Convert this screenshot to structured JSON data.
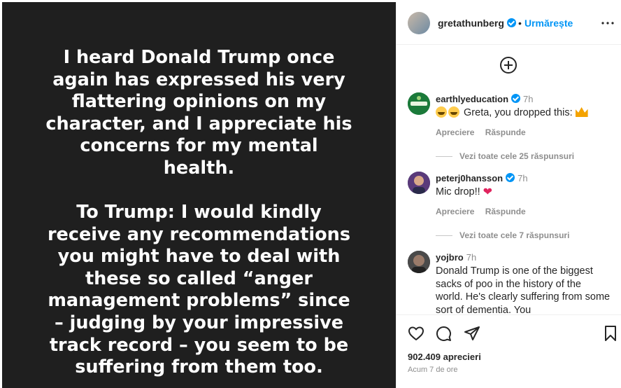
{
  "post": {
    "paragraph1": "I heard Donald Trump once\nagain has expressed his very\nflattering opinions on my\ncharacter, and I appreciate his\nconcerns for my mental\nhealth.",
    "paragraph2": "To Trump: I would kindly\nreceive any recommendations\nyou might have to deal with\nthese so called “anger\nmanagement problems” since\n– judging by your impressive\ntrack record – you seem to be\nsuffering from them too."
  },
  "header": {
    "username": "gretathunberg",
    "separator": "•",
    "follow_label": "Urmărește",
    "more_label": "•••"
  },
  "comments": [
    {
      "username": "earthlyeducation",
      "time": "7h",
      "text": "Greta, you dropped this:",
      "like_label": "Apreciere",
      "reply_label": "Răspunde",
      "replies_label": "Vezi toate cele 25 răspunsuri",
      "avatar_color": "#1b7a3a"
    },
    {
      "username": "peterj0hansson",
      "time": "7h",
      "text": "Mic drop!!",
      "like_label": "Apreciere",
      "reply_label": "Răspunde",
      "replies_label": "Vezi toate cele 7 răspunsuri",
      "avatar_color": "#3b4a7a"
    },
    {
      "username": "yojbro",
      "time": "7h",
      "text": "Donald Trump is one of the biggest sacks of poo in the history of the world. He's clearly suffering from some sort of dementia. You",
      "avatar_color": "#3a3a3a"
    }
  ],
  "footer": {
    "likes": "902.409 aprecieri",
    "posted": "Acum 7 de ore"
  },
  "colors": {
    "accent": "#0095f6",
    "media_bg": "#1f1f1f",
    "muted": "#8e8e8e"
  }
}
